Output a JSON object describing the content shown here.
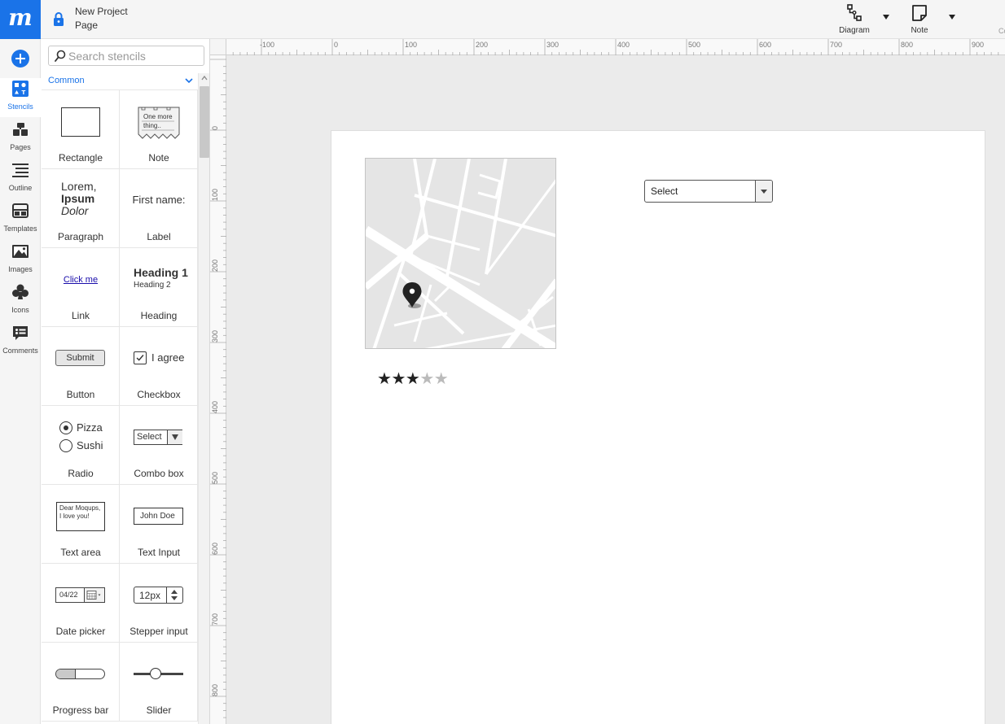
{
  "app": {
    "logo_letter": "m",
    "project_name": "New Project",
    "page_name": "Page",
    "accent": "#1a73e8"
  },
  "toolbar": {
    "diagram_label": "Diagram",
    "note_label": "Note",
    "truncated_label": "Co"
  },
  "rail": {
    "items": [
      {
        "label": "Stencils",
        "icon": "stencils-icon",
        "active": true
      },
      {
        "label": "Pages",
        "icon": "pages-icon"
      },
      {
        "label": "Outline",
        "icon": "outline-icon"
      },
      {
        "label": "Templates",
        "icon": "templates-icon"
      },
      {
        "label": "Images",
        "icon": "images-icon"
      },
      {
        "label": "Icons",
        "icon": "club-icon"
      },
      {
        "label": "Comments",
        "icon": "comments-icon"
      }
    ]
  },
  "stencils": {
    "search_placeholder": "Search stencils",
    "category": "Common",
    "items": [
      {
        "label": "Rectangle"
      },
      {
        "label": "Note",
        "preview_text": "One more thing.."
      },
      {
        "label": "Paragraph",
        "preview_lines": [
          "Lorem,",
          "Ipsum",
          "Dolor"
        ]
      },
      {
        "label": "Label",
        "preview_text": "First name:"
      },
      {
        "label": "Link",
        "preview_text": "Click me"
      },
      {
        "label": "Heading",
        "preview_h1": "Heading 1",
        "preview_h2": "Heading 2"
      },
      {
        "label": "Button",
        "preview_text": "Submit"
      },
      {
        "label": "Checkbox",
        "preview_text": "I agree",
        "checked": true
      },
      {
        "label": "Radio",
        "options": [
          "Pizza",
          "Sushi"
        ],
        "selected": "Pizza"
      },
      {
        "label": "Combo box",
        "preview_text": "Select"
      },
      {
        "label": "Text area",
        "preview_text": "Dear Moqups, I love you!"
      },
      {
        "label": "Text Input",
        "preview_text": "John Doe"
      },
      {
        "label": "Date picker",
        "preview_text": "04/22"
      },
      {
        "label": "Stepper input",
        "preview_text": "12px"
      },
      {
        "label": "Progress bar",
        "progress": 0.4
      },
      {
        "label": "Slider",
        "value": 0.45
      }
    ]
  },
  "rulers": {
    "horizontal": [
      "-100",
      "0",
      "100",
      "200",
      "300",
      "400",
      "500",
      "600",
      "700",
      "800",
      "900"
    ],
    "vertical": [
      "0",
      "100",
      "200",
      "300",
      "400",
      "500",
      "600",
      "700",
      "800"
    ]
  },
  "page_content": {
    "map": {
      "pin_icon": "map-pin-icon"
    },
    "rating": {
      "value": 3,
      "max": 5,
      "filled_color": "#222222",
      "empty_color": "#bbbbbb"
    },
    "select": {
      "value": "Select"
    }
  }
}
